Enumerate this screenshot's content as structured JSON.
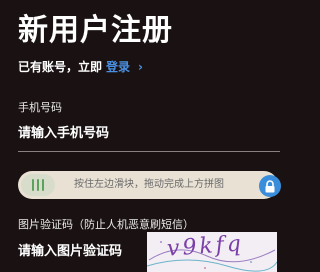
{
  "page": {
    "title": "新用户注册"
  },
  "login_prompt": {
    "text": "已有账号，立即",
    "link_label": "登录",
    "chevron": "›"
  },
  "phone": {
    "label": "手机号码",
    "placeholder": "请输入手机号码"
  },
  "slider": {
    "hint": "按住左边滑块，拖动完成上方拼图",
    "progress": 0,
    "lock_icon": "lock-icon"
  },
  "image_captcha": {
    "label": "图片验证码（防止人机恶意刷短信）",
    "placeholder": "请输入图片验证码",
    "captcha_text": "v9kfq"
  },
  "colors": {
    "background": "#1a1212",
    "link": "#4a90e2",
    "lock_badge": "#3a8ddb",
    "slider_track": "#e9e1d4",
    "knob_grip": "#5ba35c"
  }
}
